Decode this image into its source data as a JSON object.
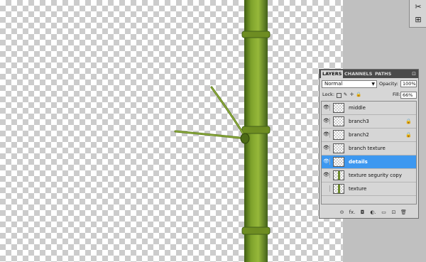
{
  "panel": {
    "tabs": [
      "LAYERS",
      "CHANNELS",
      "PATHS"
    ],
    "menu_icon": "▸≡",
    "blend_mode": "Normal",
    "opacity_label": "Opacity:",
    "opacity_value": "100%",
    "lock_label": "Lock:",
    "fill_label": "Fill:",
    "fill_value": "66%",
    "layers": [
      {
        "name": "middle",
        "visible": true,
        "locked": false,
        "selected": false
      },
      {
        "name": "branch3",
        "visible": true,
        "locked": true,
        "selected": false
      },
      {
        "name": "branch2",
        "visible": true,
        "locked": true,
        "selected": false
      },
      {
        "name": "branch texture",
        "visible": true,
        "locked": false,
        "selected": false
      },
      {
        "name": "details",
        "visible": true,
        "locked": false,
        "selected": true
      },
      {
        "name": "texture segurity copy",
        "visible": true,
        "locked": false,
        "selected": false
      },
      {
        "name": "texture",
        "visible": false,
        "locked": false,
        "selected": false
      }
    ]
  },
  "icons": {
    "eye": "👁",
    "lock": "🔒",
    "link": "⊝",
    "fx": "fx.",
    "mask": "◘",
    "adjustment": "◐.",
    "folder": "▭",
    "new_layer": "⊡",
    "trash": "🗑",
    "tool_top": "✂",
    "tool_bottom": "⊞"
  },
  "colors": {
    "selected_layer": "#3d98f0",
    "bamboo": "#7fa32c",
    "panel_bg": "#d6d6d6"
  }
}
